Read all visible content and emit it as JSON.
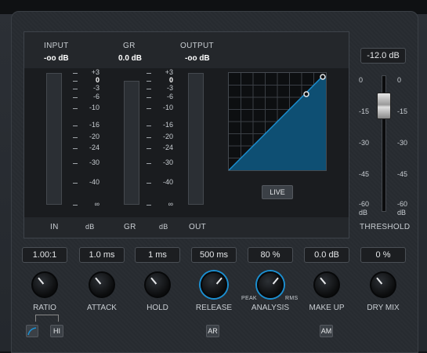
{
  "meters": {
    "input": {
      "title": "INPUT",
      "value": "-oo dB",
      "footer": "IN"
    },
    "gr": {
      "title": "GR",
      "value": "0.0 dB",
      "footer": "GR"
    },
    "output": {
      "title": "OUTPUT",
      "value": "-oo dB",
      "footer": "OUT"
    },
    "db_left": "dB",
    "db_right": "dB",
    "scale_left": [
      "+3",
      "0",
      "-3",
      "-6",
      "-10",
      "-16",
      "-20",
      "-24",
      "-30",
      "-40",
      "∞"
    ],
    "scale_right": [
      "+3",
      "0",
      "-3",
      "-6",
      "-10",
      "-16",
      "-20",
      "-24",
      "-30",
      "-40",
      "∞"
    ]
  },
  "graph": {
    "live_label": "LIVE"
  },
  "threshold": {
    "value": "-12.0 dB",
    "label": "THRESHOLD",
    "scale_left": [
      "0",
      "-15",
      "-30",
      "-45",
      "-60"
    ],
    "scale_right": [
      "0",
      "-15",
      "-30",
      "-45",
      "-60"
    ],
    "unit": "dB"
  },
  "knobs": [
    {
      "name": "ratio",
      "label": "RATIO",
      "value": "1.00:1"
    },
    {
      "name": "attack",
      "label": "ATTACK",
      "value": "1.0 ms"
    },
    {
      "name": "hold",
      "label": "HOLD",
      "value": "1 ms"
    },
    {
      "name": "release",
      "label": "RELEASE",
      "value": "500 ms"
    },
    {
      "name": "analysis",
      "label": "ANALYSIS",
      "value": "80 %",
      "min_label": "PEAK",
      "max_label": "RMS"
    },
    {
      "name": "makeup",
      "label": "MAKE UP",
      "value": "0.0 dB"
    },
    {
      "name": "drymix",
      "label": "DRY MIX",
      "value": "0 %"
    }
  ],
  "buttons": {
    "hi": "HI",
    "ar": "AR",
    "am": "AM"
  },
  "colors": {
    "accent": "#1b8fd1",
    "graph_fill": "#0e4f73",
    "panel": "#2a2e33"
  }
}
